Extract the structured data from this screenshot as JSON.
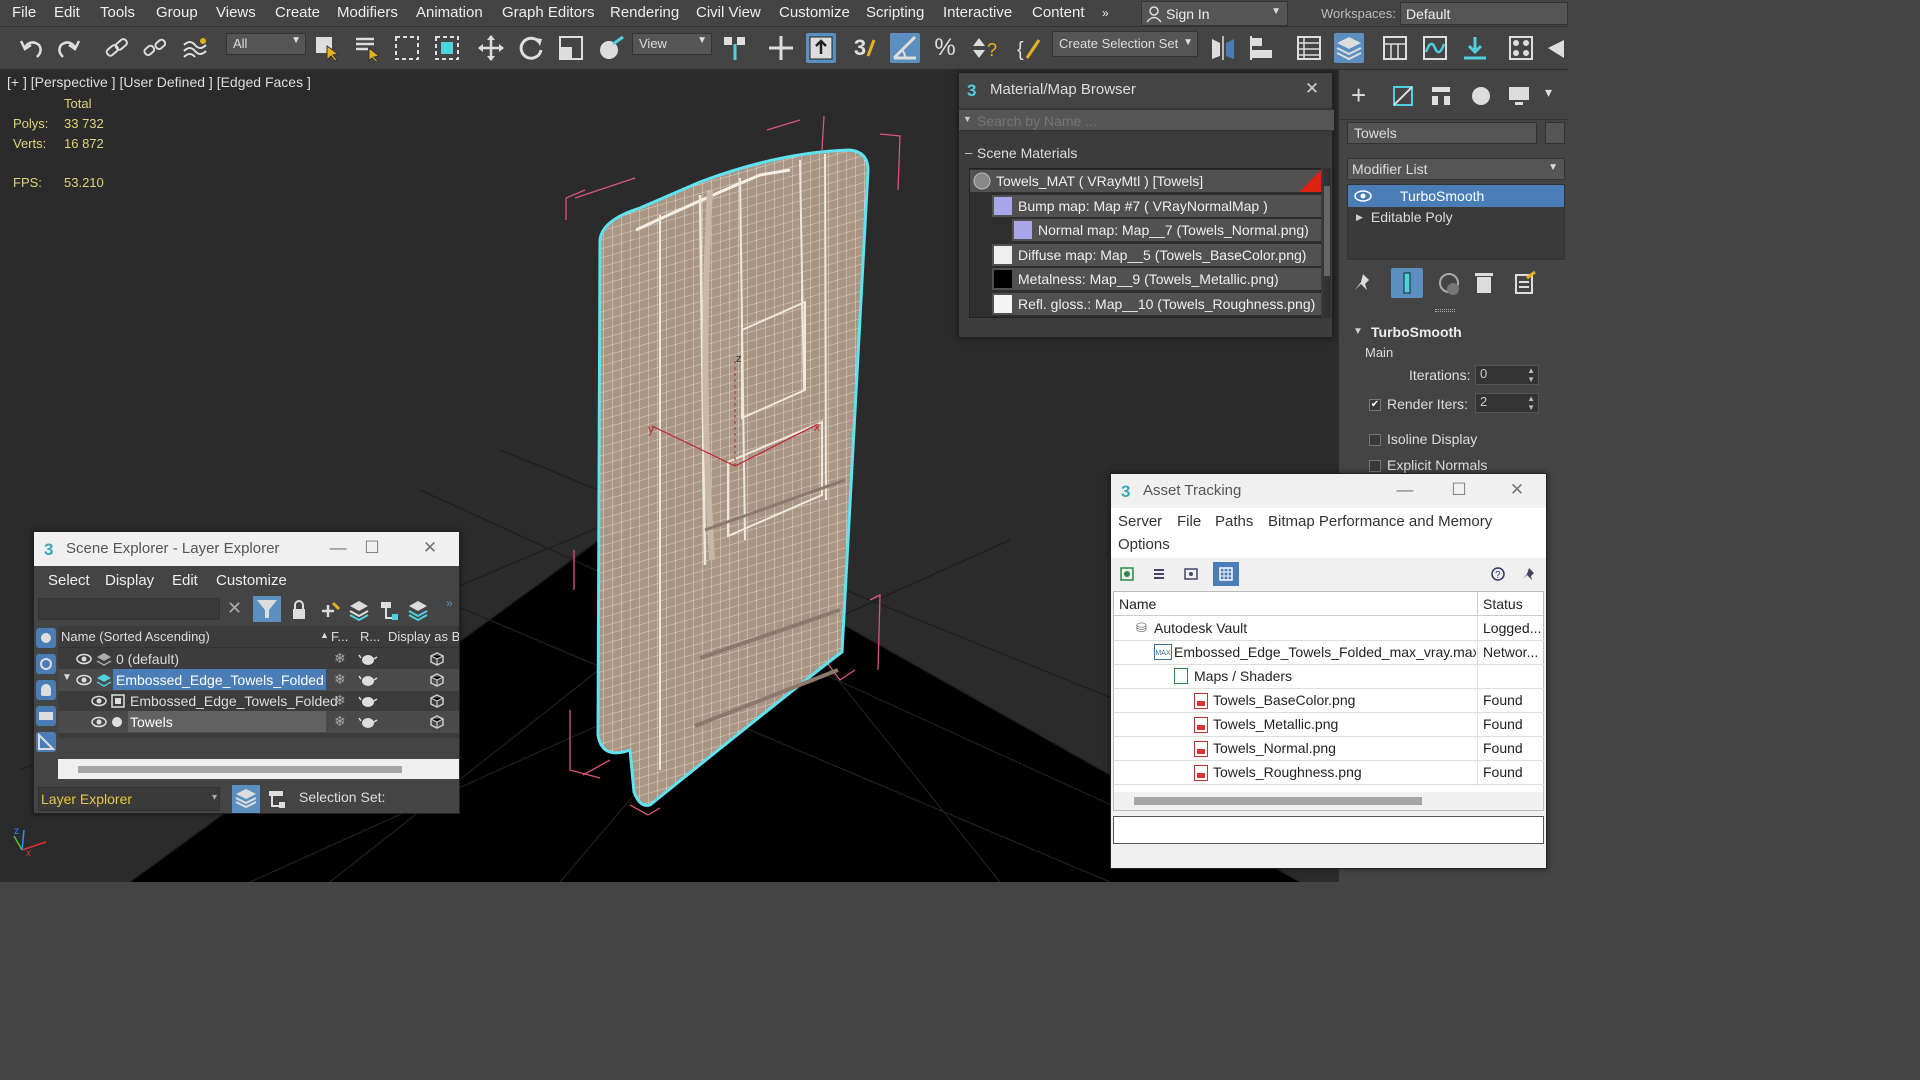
{
  "menu": [
    "File",
    "Edit",
    "Tools",
    "Group",
    "Views",
    "Create",
    "Modifiers",
    "Animation",
    "Graph Editors",
    "Rendering",
    "Civil View",
    "Customize",
    "Scripting",
    "Interactive",
    "Content"
  ],
  "menu_overflow": "»",
  "sign_in": "Sign In",
  "workspaces_label": "Workspaces:",
  "workspaces_value": "Default",
  "toolbar": {
    "filter_value": "All",
    "view_value": "View",
    "selection_set": "Create Selection Set",
    "snap_3": "3",
    "percent": "%"
  },
  "viewport": {
    "label": "[+ ] [Perspective ] [User Defined ] [Edged Faces ]",
    "stats_header": "Total",
    "polys_label": "Polys:",
    "polys_value": "33 732",
    "verts_label": "Verts:",
    "verts_value": "16 872",
    "fps_label": "FPS:",
    "fps_value": "53.210",
    "axis_x": "x",
    "axis_y": "y",
    "axis_z": "z"
  },
  "material_browser": {
    "title": "Material/Map Browser",
    "search_placeholder": "Search by Name ...",
    "section": "Scene Materials",
    "items": [
      "Towels_MAT  ( VRayMtl )  [Towels]",
      "Bump map: Map #7  ( VRayNormalMap )",
      "Normal map: Map__7 (Towels_Normal.png)",
      "Diffuse map: Map__5 (Towels_BaseColor.png)",
      "Metalness: Map__9 (Towels_Metallic.png)",
      "Refl. gloss.: Map__10 (Towels_Roughness.png)"
    ]
  },
  "scene_explorer": {
    "title": "Scene Explorer - Layer Explorer",
    "menu": [
      "Select",
      "Display",
      "Edit",
      "Customize"
    ],
    "col_name": "Name (Sorted Ascending)",
    "col_f": "F...",
    "col_r": "R...",
    "col_display": "Display as B",
    "rows": [
      "0 (default)",
      "Embossed_Edge_Towels_Folded",
      "Embossed_Edge_Towels_Folded",
      "Towels"
    ],
    "footer_dropdown": "Layer Explorer",
    "selection_set_label": "Selection Set:"
  },
  "right_panel": {
    "object_name": "Towels",
    "modifier_list": "Modifier List",
    "stack": [
      "TurboSmooth",
      "Editable Poly"
    ],
    "rollout_title": "TurboSmooth",
    "main_label": "Main",
    "iterations_label": "Iterations:",
    "iterations_value": "0",
    "render_iters_label": "Render Iters:",
    "render_iters_value": "2",
    "isoline": "Isoline Display",
    "explicit_normals": "Explicit Normals"
  },
  "asset_tracking": {
    "title": "Asset Tracking",
    "menu": [
      "Server",
      "File",
      "Paths",
      "Bitmap Performance and Memory",
      "Options"
    ],
    "col_name": "Name",
    "col_status": "Status",
    "rows": [
      {
        "name": "Autodesk Vault",
        "status": "Logged..."
      },
      {
        "name": "Embossed_Edge_Towels_Folded_max_vray.max",
        "status": "Networ..."
      },
      {
        "name": "Maps / Shaders",
        "status": ""
      },
      {
        "name": "Towels_BaseColor.png",
        "status": "Found"
      },
      {
        "name": "Towels_Metallic.png",
        "status": "Found"
      },
      {
        "name": "Towels_Normal.png",
        "status": "Found"
      },
      {
        "name": "Towels_Roughness.png",
        "status": "Found"
      }
    ]
  },
  "colors": {
    "accent": "#5b8fc0",
    "selected_row": "#4a7db5",
    "hud_text": "#e0d27a",
    "wire_cyan": "#5fe3f0",
    "bbox_pink": "#d9567a"
  }
}
